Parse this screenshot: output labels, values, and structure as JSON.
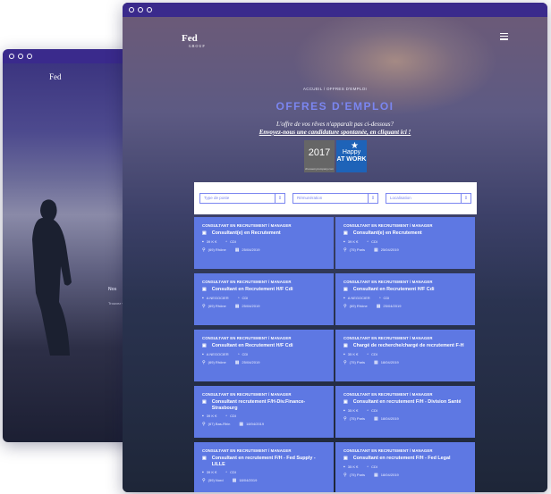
{
  "back_window": {
    "logo": "Fed",
    "text_line1": "Nos",
    "text_line2": "Trouvez votre"
  },
  "front_window": {
    "logo": "Fed",
    "logo_sub": "GROUP",
    "breadcrumb": "ACCUEIL  /  OFFRES D'EMPLOI",
    "page_title": "OFFRES D'EMPLOI",
    "subtitle_line1": "L'offre de vos rêves n'apparaît pas ci-dessous?",
    "subtitle_line2": "Envoyez-nous une candidature spontanée, en cliquant ici !",
    "badge_2017": {
      "year": "2017",
      "caption": "choosemycompany.com"
    },
    "badge_happy": {
      "line1": "Happy",
      "line2": "AT WORK"
    },
    "filters": [
      {
        "placeholder": "Type de poste"
      },
      {
        "placeholder": "Rémunération"
      },
      {
        "placeholder": "Localisation"
      }
    ],
    "jobs": [
      {
        "category": "CONSULTANT EN RECRUTEMENT / MANAGER",
        "title": "Consultant(e) en Recrutement",
        "salary": "39 K €",
        "contract": "CDI",
        "location": "(69) Rhône",
        "date": "25/04/2019"
      },
      {
        "category": "CONSULTANT EN RECRUTEMENT / MANAGER",
        "title": "Consultant(e) en Recrutement",
        "salary": "39 K €",
        "contract": "CDI",
        "location": "(75) Paris",
        "date": "25/04/2019"
      },
      {
        "category": "CONSULTANT EN RECRUTEMENT / MANAGER",
        "title": "Consultant en Recrutement H/F Cdi",
        "salary": "A NEGOCIER",
        "contract": "CDI",
        "location": "(69) Rhône",
        "date": "25/04/2019"
      },
      {
        "category": "CONSULTANT EN RECRUTEMENT / MANAGER",
        "title": "Consultant en Recrutement H/F Cdi",
        "salary": "A NEGOCIER",
        "contract": "CDI",
        "location": "(69) Rhône",
        "date": "25/04/2019"
      },
      {
        "category": "CONSULTANT EN RECRUTEMENT / MANAGER",
        "title": "Consultant en Recrutement H/F Cdi",
        "salary": "A NEGOCIER",
        "contract": "CDI",
        "location": "(69) Rhône",
        "date": "25/04/2019"
      },
      {
        "category": "CONSULTANT EN RECRUTEMENT / MANAGER",
        "title": "Chargé de recherche/chargé de recrutement F-H",
        "salary": "35 K €",
        "contract": "CDI",
        "location": "(75) Paris",
        "date": "18/04/2019"
      },
      {
        "category": "CONSULTANT EN RECRUTEMENT / MANAGER",
        "title": "Consultant recrutement F/H-Div.Finance-Strasbourg",
        "salary": "39 K €",
        "contract": "CDI",
        "location": "(67) Bas-Rhin",
        "date": "18/04/2019"
      },
      {
        "category": "CONSULTANT EN RECRUTEMENT / MANAGER",
        "title": "Consultant en recrutement F/H - Division Santé",
        "salary": "35 K €",
        "contract": "CDI",
        "location": "(75) Paris",
        "date": "18/04/2019"
      },
      {
        "category": "CONSULTANT EN RECRUTEMENT / MANAGER",
        "title": "Consultant en recrutement F/H - Fed Supply - LILLE",
        "salary": "39 K €",
        "contract": "CDI",
        "location": "(59) Nord",
        "date": "18/04/2019"
      },
      {
        "category": "CONSULTANT EN RECRUTEMENT / MANAGER",
        "title": "Consultant en recrutement F/H - Fed Legal",
        "salary": "35 K €",
        "contract": "CDI",
        "location": "(75) Paris",
        "date": "18/04/2019"
      }
    ]
  }
}
